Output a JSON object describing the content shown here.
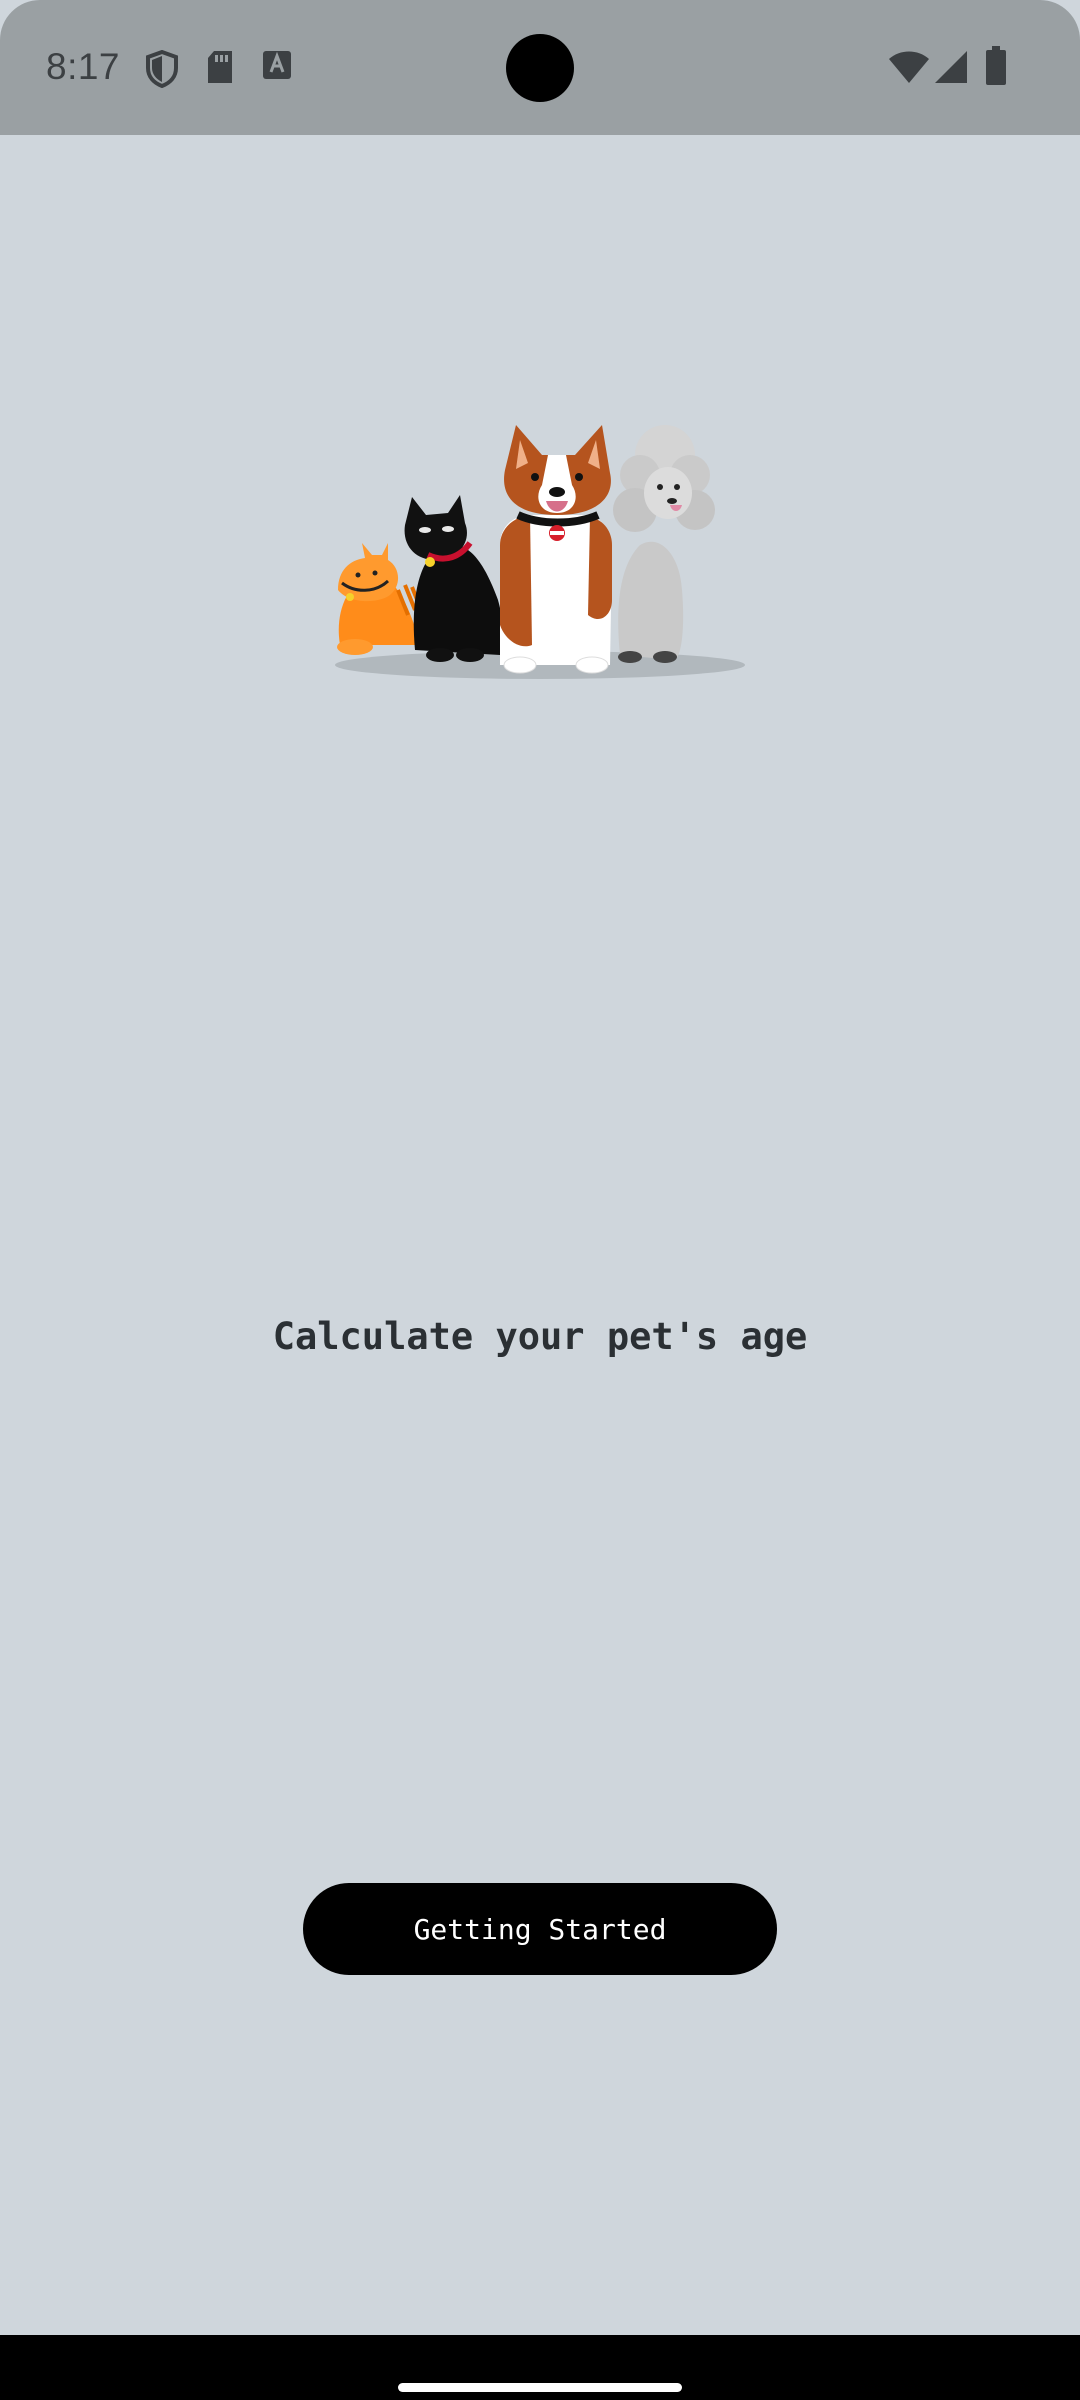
{
  "status_bar": {
    "time": "8:17",
    "left_icons": [
      "shield-icon",
      "sd-card-icon",
      "text-a-icon"
    ],
    "right_icons": [
      "wifi-icon",
      "signal-icon",
      "battery-icon"
    ]
  },
  "main": {
    "illustration": "pets-illustration",
    "headline": "Calculate your pet's age",
    "cta_label": "Getting Started"
  },
  "colors": {
    "background": "#cfd6dc",
    "status_bar": "#9aa0a3",
    "button": "#000000",
    "button_text": "#ffffff",
    "headline": "#2b3034"
  }
}
